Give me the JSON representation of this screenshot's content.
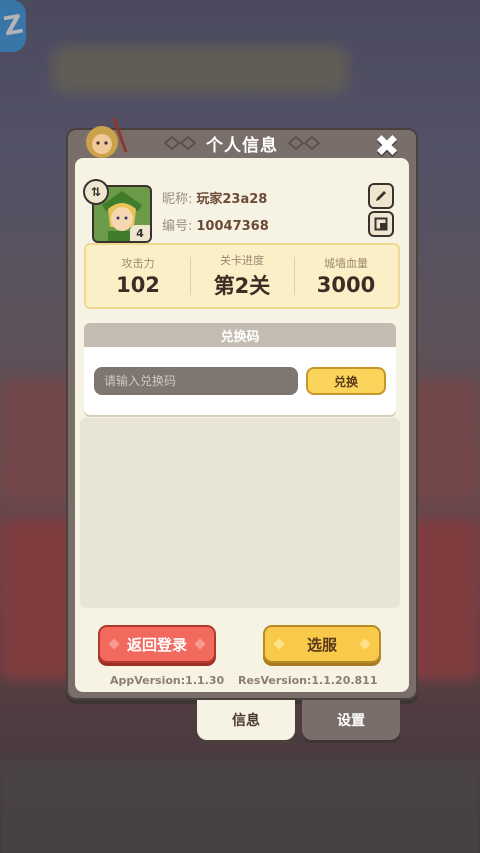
{
  "header": {
    "title": "个人信息"
  },
  "profile": {
    "nickname_label": "昵称:",
    "nickname": "玩家23a28",
    "id_label": "编号:",
    "id": "10047368",
    "level": "4"
  },
  "stats": [
    {
      "label": "攻击力",
      "value": "102"
    },
    {
      "label": "关卡进度",
      "value": "第2关"
    },
    {
      "label": "城墙血量",
      "value": "3000"
    }
  ],
  "redeem": {
    "title": "兑换码",
    "placeholder": "请输入兑换码",
    "button": "兑换"
  },
  "actions": {
    "back_login": "返回登录",
    "select_server": "选服"
  },
  "versions": {
    "app": "AppVersion:1.1.30",
    "res": "ResVersion:1.1.20.811"
  },
  "tabs": [
    {
      "label": "信息",
      "active": true
    },
    {
      "label": "设置",
      "active": false
    }
  ],
  "colors": {
    "accent_yellow": "#f9c94a",
    "accent_red": "#f26a5e",
    "panel_bg": "#f7f3e4",
    "frame": "#7a6e6a"
  }
}
